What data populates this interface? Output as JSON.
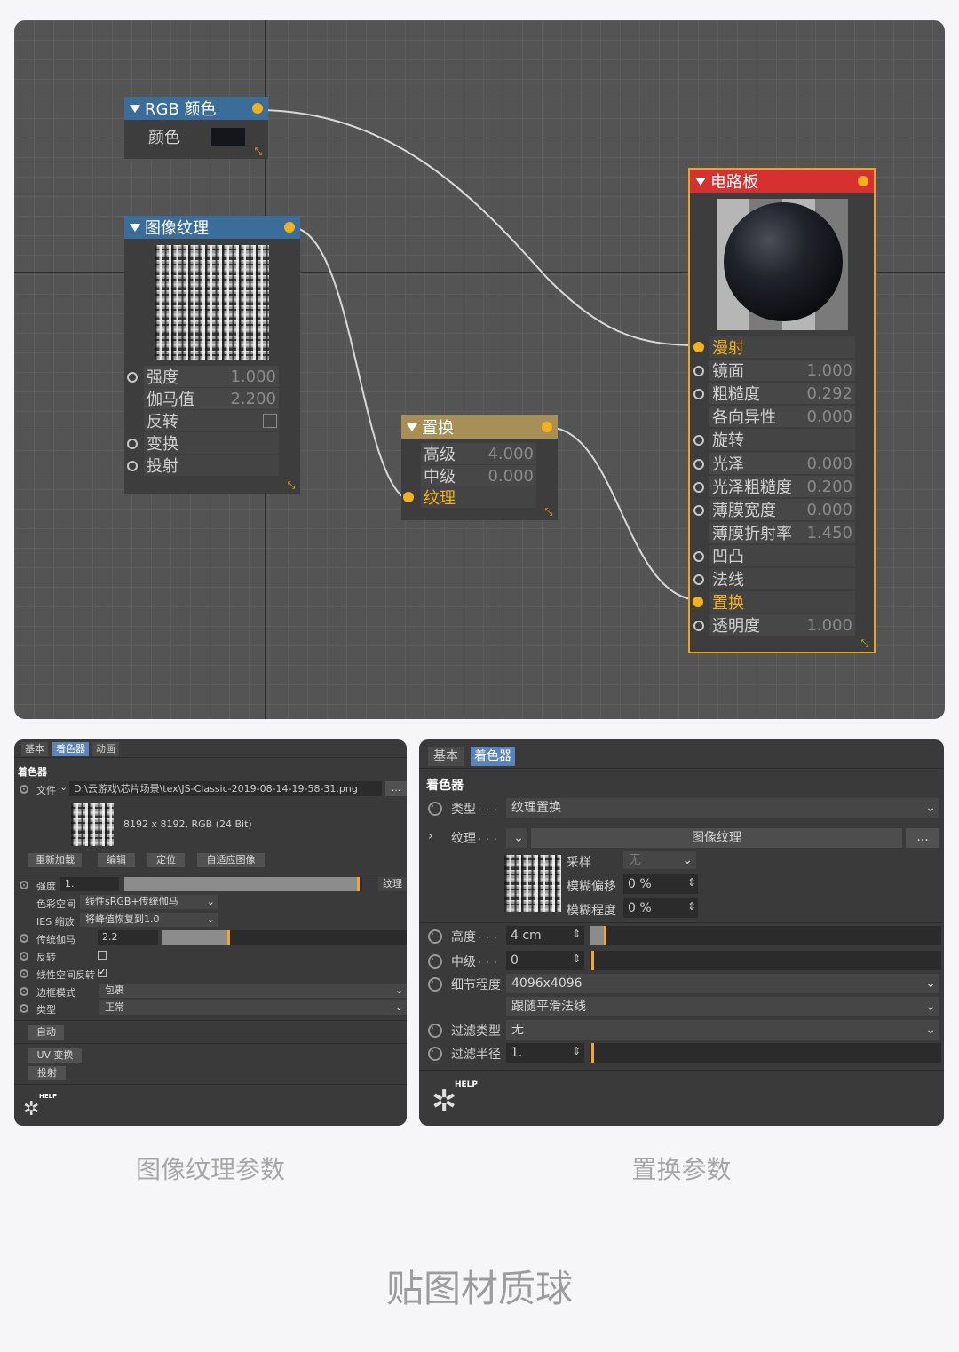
{
  "editor": {
    "nodes": {
      "rgb": {
        "title": "RGB 颜色",
        "rows": [
          {
            "label": "颜色"
          }
        ],
        "swatch": "#15161b",
        "header_color": "#3a6d9a"
      },
      "image": {
        "title": "图像纹理",
        "header_color": "#3a6d9a",
        "rows": [
          {
            "label": "强度",
            "value": "1.000"
          },
          {
            "label": "伽马值",
            "value": "2.200"
          },
          {
            "label": "反转"
          },
          {
            "label": "变换"
          },
          {
            "label": "投射"
          }
        ]
      },
      "displace": {
        "title": "置换",
        "header_color": "#a78f55",
        "rows": [
          {
            "label": "高级",
            "value": "4.000"
          },
          {
            "label": "中级",
            "value": "0.000"
          },
          {
            "label": "纹理"
          }
        ]
      },
      "circuit": {
        "title": "电路板",
        "header_color": "#d83030",
        "rows": [
          {
            "label": "漫射"
          },
          {
            "label": "镜面",
            "value": "1.000"
          },
          {
            "label": "粗糙度",
            "value": "0.292"
          },
          {
            "label": "各向异性",
            "value": "0.000"
          },
          {
            "label": "旋转"
          },
          {
            "label": "光泽",
            "value": "0.000"
          },
          {
            "label": "光泽粗糙度",
            "value": "0.200"
          },
          {
            "label": "薄膜宽度",
            "value": "0.000"
          },
          {
            "label": "薄膜折射率",
            "value": "1.450"
          },
          {
            "label": "凹凸"
          },
          {
            "label": "法线"
          },
          {
            "label": "置换"
          },
          {
            "label": "透明度",
            "value": "1.000"
          }
        ]
      }
    },
    "accent": "#f4b21a"
  },
  "left_panel": {
    "tabs": [
      "基本",
      "着色器",
      "动画"
    ],
    "section": "着色器",
    "file_label": "文件",
    "file_path": "D:\\云游戏\\芯片场景\\tex\\JS-Classic-2019-08-14-19-58-31.png",
    "browse": "...",
    "image_info": "8192 x 8192, RGB (24 Bit)",
    "buttons": [
      "重新加载",
      "编辑",
      "定位",
      "自适应图像"
    ],
    "strength_label": "强度",
    "strength_value": "1.",
    "strength_btn": "纹理",
    "colorspace_label": "色彩空间",
    "colorspace_value": "线性sRGB+传统伽马",
    "ies_label": "IES 缩放",
    "ies_value": "将峰值恢复到1.0",
    "gamma_label": "传统伽马",
    "gamma_value": "2.2",
    "invert_label": "反转",
    "linear_invert_label": "线性空间反转",
    "border_label": "边框模式",
    "border_value": "包裹",
    "type_label": "类型",
    "type_value": "正常",
    "auto_btn": "自动",
    "uv_btn": "UV 变换",
    "proj_btn": "投射",
    "help": "HELP"
  },
  "right_panel": {
    "tabs": [
      "基本",
      "着色器"
    ],
    "section": "着色器",
    "type_label": "类型",
    "type_value": "纹理置换",
    "texture_label": "纹理",
    "texture_value": "图像纹理",
    "browse": "...",
    "sample_label": "采样",
    "sample_value": "无",
    "blur_offset_label": "模糊偏移",
    "blur_offset_value": "0 %",
    "blur_amount_label": "模糊程度",
    "blur_amount_value": "0 %",
    "height_label": "高度",
    "height_value": "4 cm",
    "mid_label": "中级",
    "mid_value": "0",
    "detail_label": "细节程度",
    "detail_value": "4096x4096",
    "follow_value": "跟随平滑法线",
    "filter_type_label": "过滤类型",
    "filter_type_value": "无",
    "filter_radius_label": "过滤半径",
    "filter_radius_value": "1.",
    "help": "HELP"
  },
  "captions": {
    "left": "图像纹理参数",
    "right": "置换参数",
    "main": "贴图材质球"
  }
}
